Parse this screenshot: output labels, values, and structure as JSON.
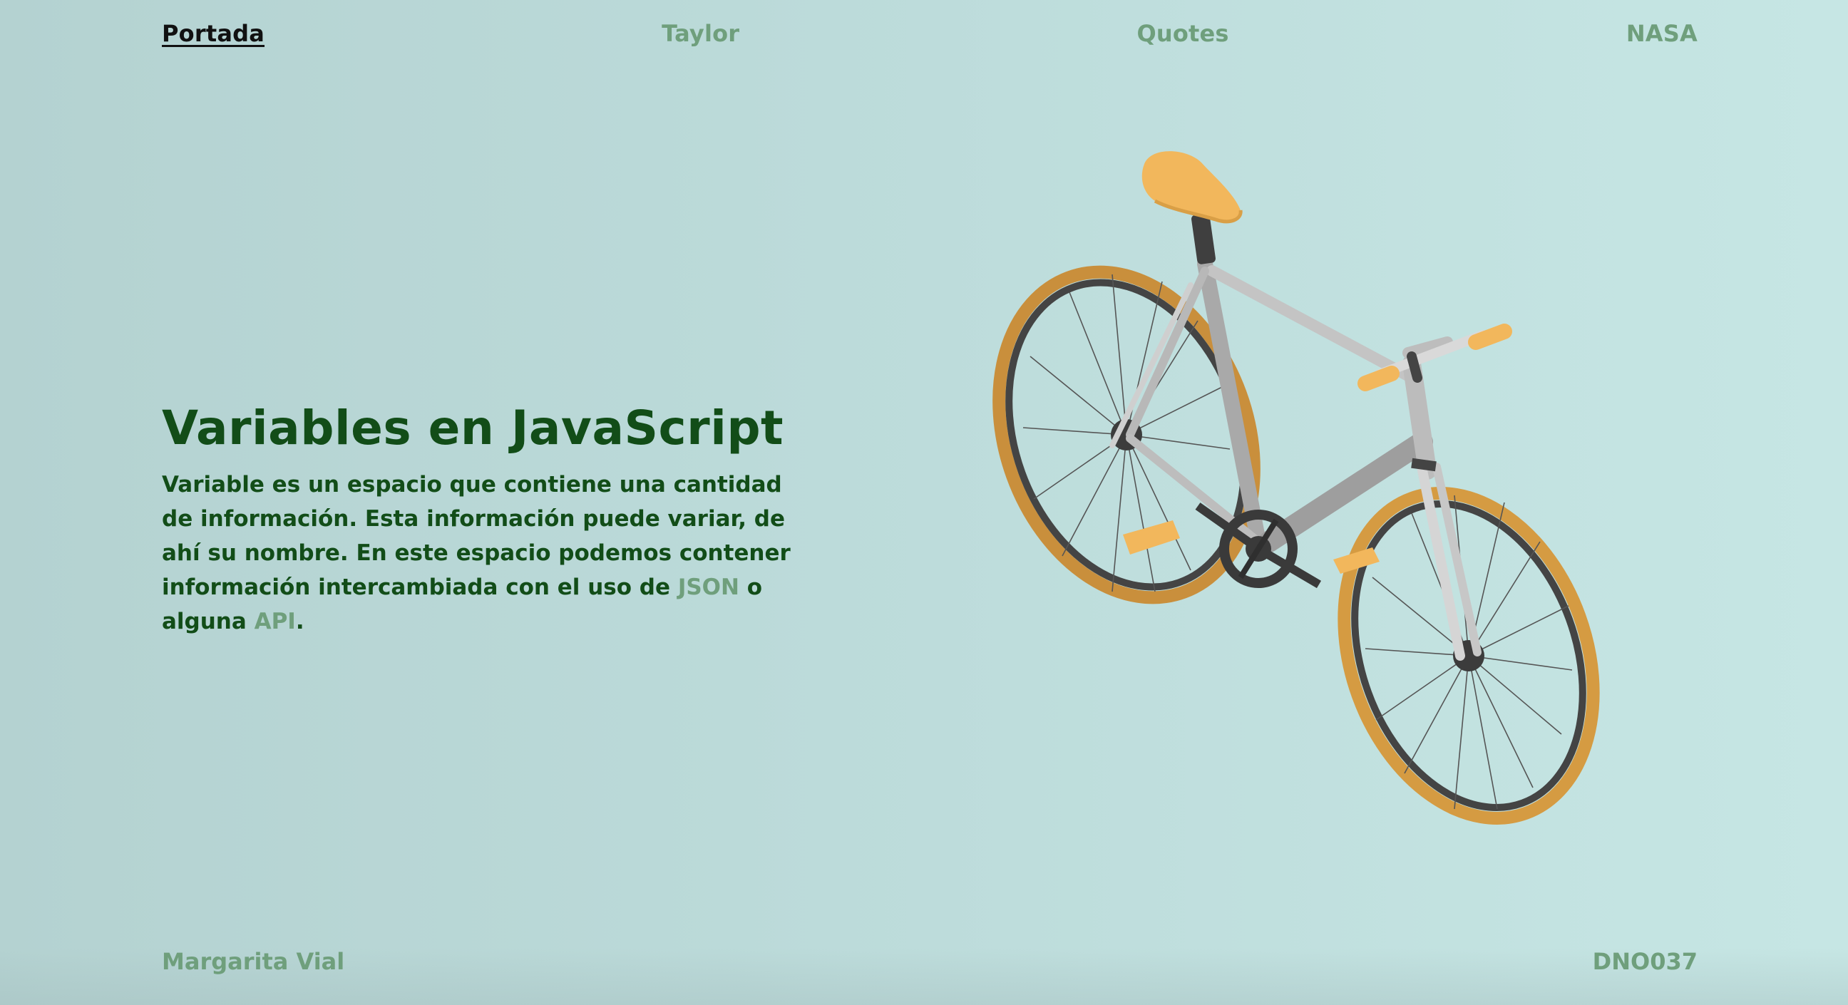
{
  "nav": {
    "items": [
      {
        "label": "Portada",
        "active": true
      },
      {
        "label": "Taylor",
        "active": false
      },
      {
        "label": "Quotes",
        "active": false
      },
      {
        "label": "NASA",
        "active": false
      }
    ]
  },
  "hero": {
    "title": "Variables en JavaScript",
    "description_before": "Variable es un espacio que contiene una cantidad de información. Esta información puede variar, de ahí su nombre. En este espacio podemos contener información intercambiada con el uso de ",
    "link_json": "JSON",
    "description_middle": " o alguna ",
    "link_api": "API",
    "description_end": "."
  },
  "illustration": {
    "subject": "bicycle-icon",
    "colors": {
      "tire": "#c98f3c",
      "seat": "#f2b75c",
      "frame": "#b9b9b9",
      "rim": "#4a4a4a"
    }
  },
  "footer": {
    "author": "Margarita Vial",
    "code": "DNO037"
  },
  "colors": {
    "heading": "#124d18",
    "link": "#6f9f7c",
    "active": "#111111",
    "background_start": "#b4d2d1",
    "background_end": "#c6e6e4"
  }
}
